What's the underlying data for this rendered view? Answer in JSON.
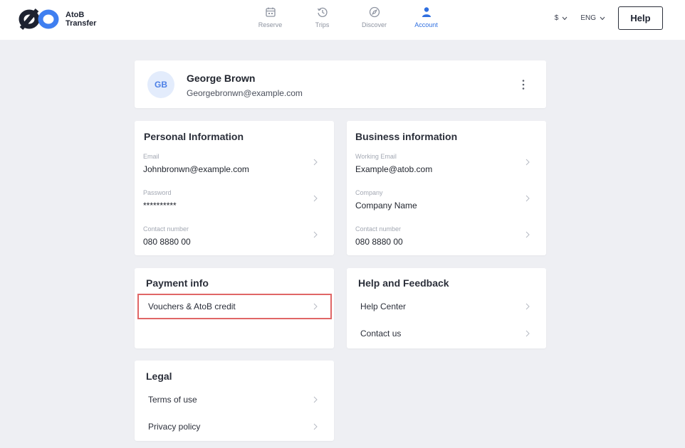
{
  "brand": {
    "line1": "AtoB",
    "line2": "Transfer"
  },
  "nav": [
    {
      "label": "Reserve",
      "icon": "calendar-icon"
    },
    {
      "label": "Trips",
      "icon": "history-icon"
    },
    {
      "label": "Discover",
      "icon": "compass-icon"
    },
    {
      "label": "Account",
      "icon": "user-icon"
    }
  ],
  "header": {
    "currency": "$",
    "language": "ENG",
    "help_label": "Help"
  },
  "profile": {
    "initials": "GB",
    "name": "George Brown",
    "email": "Georgebronwn@example.com"
  },
  "personal": {
    "title": "Personal Information",
    "fields": [
      {
        "label": "Email",
        "value": "Johnbronwn@example.com"
      },
      {
        "label": "Password",
        "value": "**********"
      },
      {
        "label": "Contact number",
        "value": "080 8880 00"
      }
    ]
  },
  "business": {
    "title": "Business information",
    "fields": [
      {
        "label": "Working Email",
        "value": "Example@atob.com"
      },
      {
        "label": "Company",
        "value": "Company Name"
      },
      {
        "label": "Contact number",
        "value": "080 8880 00"
      }
    ]
  },
  "payment": {
    "title": "Payment info",
    "items": [
      "Vouchers & AtoB credit"
    ]
  },
  "help_feedback": {
    "title": "Help and Feedback",
    "items": [
      "Help Center",
      "Contact us"
    ]
  },
  "legal": {
    "title": "Legal",
    "items": [
      "Terms of use",
      "Privacy policy"
    ]
  },
  "colors": {
    "accent": "#2f6fe0",
    "highlight": "#e06666",
    "background": "#eeeff3"
  }
}
